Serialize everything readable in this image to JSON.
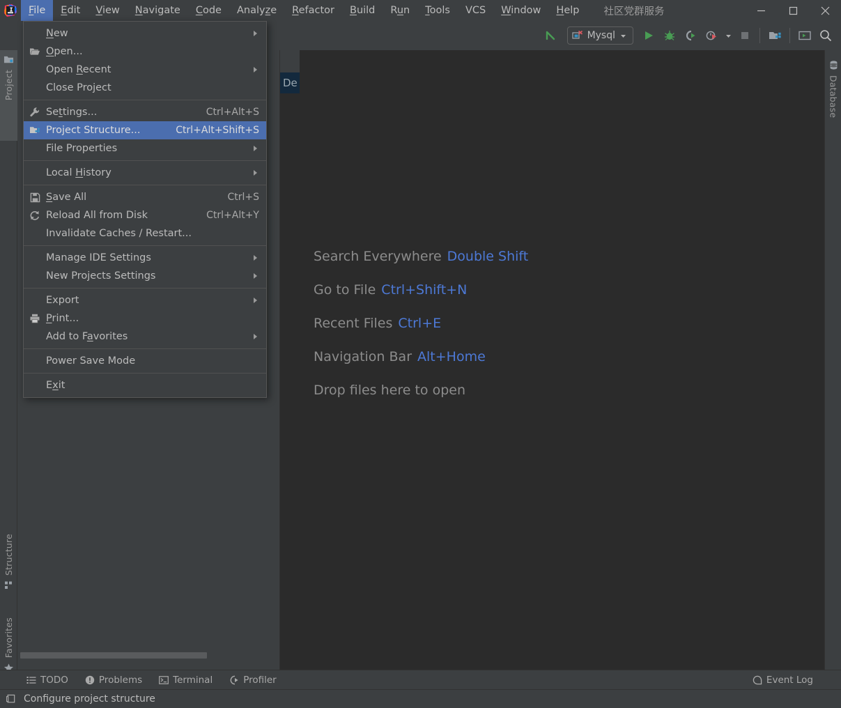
{
  "window": {
    "title": "社区党群服务",
    "minimize_label": "Minimize",
    "maximize_label": "Maximize",
    "close_label": "Close"
  },
  "menubar": {
    "items": [
      {
        "label": "File",
        "mnemonic": "F",
        "active": true
      },
      {
        "label": "Edit",
        "mnemonic": "E",
        "active": false
      },
      {
        "label": "View",
        "mnemonic": "V",
        "active": false
      },
      {
        "label": "Navigate",
        "mnemonic": "N",
        "active": false
      },
      {
        "label": "Code",
        "mnemonic": "C",
        "active": false
      },
      {
        "label": "Analyze",
        "mnemonic": "z",
        "active": false
      },
      {
        "label": "Refactor",
        "mnemonic": "R",
        "active": false
      },
      {
        "label": "Build",
        "mnemonic": "B",
        "active": false
      },
      {
        "label": "Run",
        "mnemonic": "u",
        "active": false
      },
      {
        "label": "Tools",
        "mnemonic": "T",
        "active": false
      },
      {
        "label": "VCS",
        "mnemonic": "",
        "active": false
      },
      {
        "label": "Window",
        "mnemonic": "W",
        "active": false
      },
      {
        "label": "Help",
        "mnemonic": "H",
        "active": false
      }
    ]
  },
  "file_menu": {
    "groups": [
      [
        {
          "label": "New",
          "mnemonic": "N",
          "shortcut": "",
          "submenu": true,
          "icon": "",
          "highlighted": false
        },
        {
          "label": "Open...",
          "mnemonic": "O",
          "shortcut": "",
          "submenu": false,
          "icon": "folder-open-icon",
          "highlighted": false
        },
        {
          "label": "Open Recent",
          "mnemonic": "R",
          "shortcut": "",
          "submenu": true,
          "icon": "",
          "highlighted": false
        },
        {
          "label": "Close Project",
          "mnemonic": "",
          "shortcut": "",
          "submenu": false,
          "icon": "",
          "highlighted": false
        }
      ],
      [
        {
          "label": "Settings...",
          "mnemonic": "t",
          "shortcut": "Ctrl+Alt+S",
          "submenu": false,
          "icon": "wrench-icon",
          "highlighted": false
        },
        {
          "label": "Project Structure...",
          "mnemonic": "",
          "shortcut": "Ctrl+Alt+Shift+S",
          "submenu": false,
          "icon": "project-structure-icon",
          "highlighted": true
        },
        {
          "label": "File Properties",
          "mnemonic": "",
          "shortcut": "",
          "submenu": true,
          "icon": "",
          "highlighted": false
        }
      ],
      [
        {
          "label": "Local History",
          "mnemonic": "H",
          "shortcut": "",
          "submenu": true,
          "icon": "",
          "highlighted": false
        }
      ],
      [
        {
          "label": "Save All",
          "mnemonic": "S",
          "shortcut": "Ctrl+S",
          "submenu": false,
          "icon": "save-icon",
          "highlighted": false
        },
        {
          "label": "Reload All from Disk",
          "mnemonic": "",
          "shortcut": "Ctrl+Alt+Y",
          "submenu": false,
          "icon": "reload-icon",
          "highlighted": false
        },
        {
          "label": "Invalidate Caches / Restart...",
          "mnemonic": "",
          "shortcut": "",
          "submenu": false,
          "icon": "",
          "highlighted": false
        }
      ],
      [
        {
          "label": "Manage IDE Settings",
          "mnemonic": "",
          "shortcut": "",
          "submenu": true,
          "icon": "",
          "highlighted": false
        },
        {
          "label": "New Projects Settings",
          "mnemonic": "",
          "shortcut": "",
          "submenu": true,
          "icon": "",
          "highlighted": false
        }
      ],
      [
        {
          "label": "Export",
          "mnemonic": "",
          "shortcut": "",
          "submenu": true,
          "icon": "",
          "highlighted": false
        },
        {
          "label": "Print...",
          "mnemonic": "P",
          "shortcut": "",
          "submenu": false,
          "icon": "print-icon",
          "highlighted": false
        },
        {
          "label": "Add to Favorites",
          "mnemonic": "a",
          "shortcut": "",
          "submenu": true,
          "icon": "",
          "highlighted": false
        }
      ],
      [
        {
          "label": "Power Save Mode",
          "mnemonic": "",
          "shortcut": "",
          "submenu": false,
          "icon": "",
          "highlighted": false
        }
      ],
      [
        {
          "label": "Exit",
          "mnemonic": "x",
          "shortcut": "",
          "submenu": false,
          "icon": "",
          "highlighted": false
        }
      ]
    ]
  },
  "toolbar": {
    "back_label": "Back",
    "run_config": {
      "name": "Mysql",
      "icon": "db-error-icon",
      "dropdown_icon": "chevron-down-icon"
    },
    "buttons": [
      {
        "name": "run-button",
        "label": "Run"
      },
      {
        "name": "debug-button",
        "label": "Debug"
      },
      {
        "name": "coverage-button",
        "label": "Run with Coverage"
      },
      {
        "name": "profile-button",
        "label": "Profile"
      },
      {
        "name": "stop-button",
        "label": "Stop"
      },
      {
        "name": "project-structure-button",
        "label": "Project Structure"
      },
      {
        "name": "terminal-button",
        "label": "Terminal"
      },
      {
        "name": "search-button",
        "label": "Search Everywhere"
      }
    ]
  },
  "left_tool_tabs": [
    {
      "label": "Project",
      "icon": "project-icon",
      "selected": true
    },
    {
      "label": "Structure",
      "icon": "structure-icon",
      "selected": false
    },
    {
      "label": "Favorites",
      "icon": "favorites-star-icon",
      "selected": false
    }
  ],
  "right_tool_tabs": [
    {
      "label": "Database",
      "icon": "database-icon",
      "selected": false
    }
  ],
  "editor": {
    "ghost_tab_label": "De",
    "hints": [
      {
        "action": "Search Everywhere",
        "shortcut": "Double Shift"
      },
      {
        "action": "Go to File",
        "shortcut": "Ctrl+Shift+N"
      },
      {
        "action": "Recent Files",
        "shortcut": "Ctrl+E"
      },
      {
        "action": "Navigation Bar",
        "shortcut": "Alt+Home"
      },
      {
        "action": "Drop files here to open",
        "shortcut": ""
      }
    ]
  },
  "bottom_tools": [
    {
      "label": "TODO",
      "icon": "todo-list-icon"
    },
    {
      "label": "Problems",
      "icon": "problems-icon"
    },
    {
      "label": "Terminal",
      "icon": "terminal-icon"
    },
    {
      "label": "Profiler",
      "icon": "profiler-icon"
    }
  ],
  "bottom_tools_right": [
    {
      "label": "Event Log",
      "icon": "event-log-icon"
    }
  ],
  "statusbar": {
    "message": "Configure project structure",
    "icon": "status-hint-icon"
  },
  "colors": {
    "accent_selection": "#4b6eaf",
    "menu_bg": "#3c3f41",
    "editor_bg": "#2b2b2b",
    "hint_key": "#4d79d6",
    "text": "#bbbbbb",
    "run_green": "#499c54"
  }
}
